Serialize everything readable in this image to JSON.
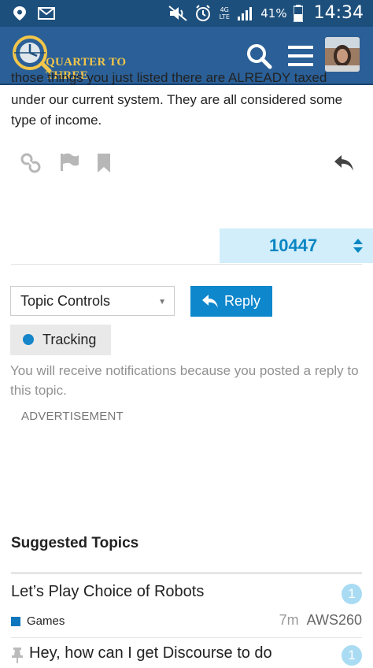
{
  "status_bar": {
    "battery": "41%",
    "time": "14:34",
    "network": "4G LTE"
  },
  "header": {
    "logo_text": "QUARTER TO THREE",
    "icons": [
      "search-icon",
      "menu-icon"
    ]
  },
  "post": {
    "text_cut": "those things you just listed there are ALREADY taxed",
    "text": "under our current system. They are all considered some type of income.",
    "actions": [
      "link-icon",
      "flag-icon",
      "bookmark-icon",
      "reply-icon"
    ]
  },
  "counter": {
    "value": "10447"
  },
  "controls": {
    "topic_controls": "Topic Controls",
    "reply": "Reply",
    "tracking": "Tracking",
    "notification_text": "You will receive notifications because you posted a reply to this topic."
  },
  "advertisement_label": "ADVERTISEMENT",
  "suggested": {
    "title": "Suggested Topics",
    "topics": [
      {
        "title": "Let’s Play Choice of Robots",
        "badge": "1",
        "category": "Games",
        "age": "7m",
        "user": "AWS260"
      },
      {
        "title": "Hey, how can I get Discourse to do",
        "badge": "1"
      }
    ]
  },
  "colors": {
    "header_bg": "#2a5f97",
    "status_bg": "#1d4f7c",
    "accent": "#0e87cc",
    "counter_bg": "#d1eefa",
    "category_games": "#0e76bd"
  }
}
